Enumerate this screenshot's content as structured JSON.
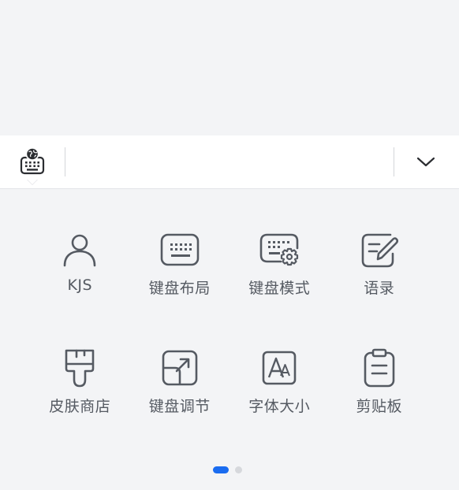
{
  "toolbar": {
    "keyboard_switch_icon": "globe-keyboard-icon",
    "collapse_icon": "chevron-down-icon"
  },
  "functions": [
    {
      "label": "KJS",
      "icon": "person-icon"
    },
    {
      "label": "键盘布局",
      "icon": "keyboard-icon"
    },
    {
      "label": "键盘模式",
      "icon": "keyboard-settings-icon"
    },
    {
      "label": "语录",
      "icon": "edit-note-icon"
    },
    {
      "label": "皮肤商店",
      "icon": "paint-brush-icon"
    },
    {
      "label": "键盘调节",
      "icon": "resize-icon"
    },
    {
      "label": "字体大小",
      "icon": "font-size-icon"
    },
    {
      "label": "剪贴板",
      "icon": "clipboard-icon"
    }
  ],
  "pager": {
    "pages": 2,
    "current": 1
  },
  "colors": {
    "background": "#f3f4f6",
    "toolbar": "#ffffff",
    "icon": "#555a62",
    "accent": "#1a6cf0"
  }
}
